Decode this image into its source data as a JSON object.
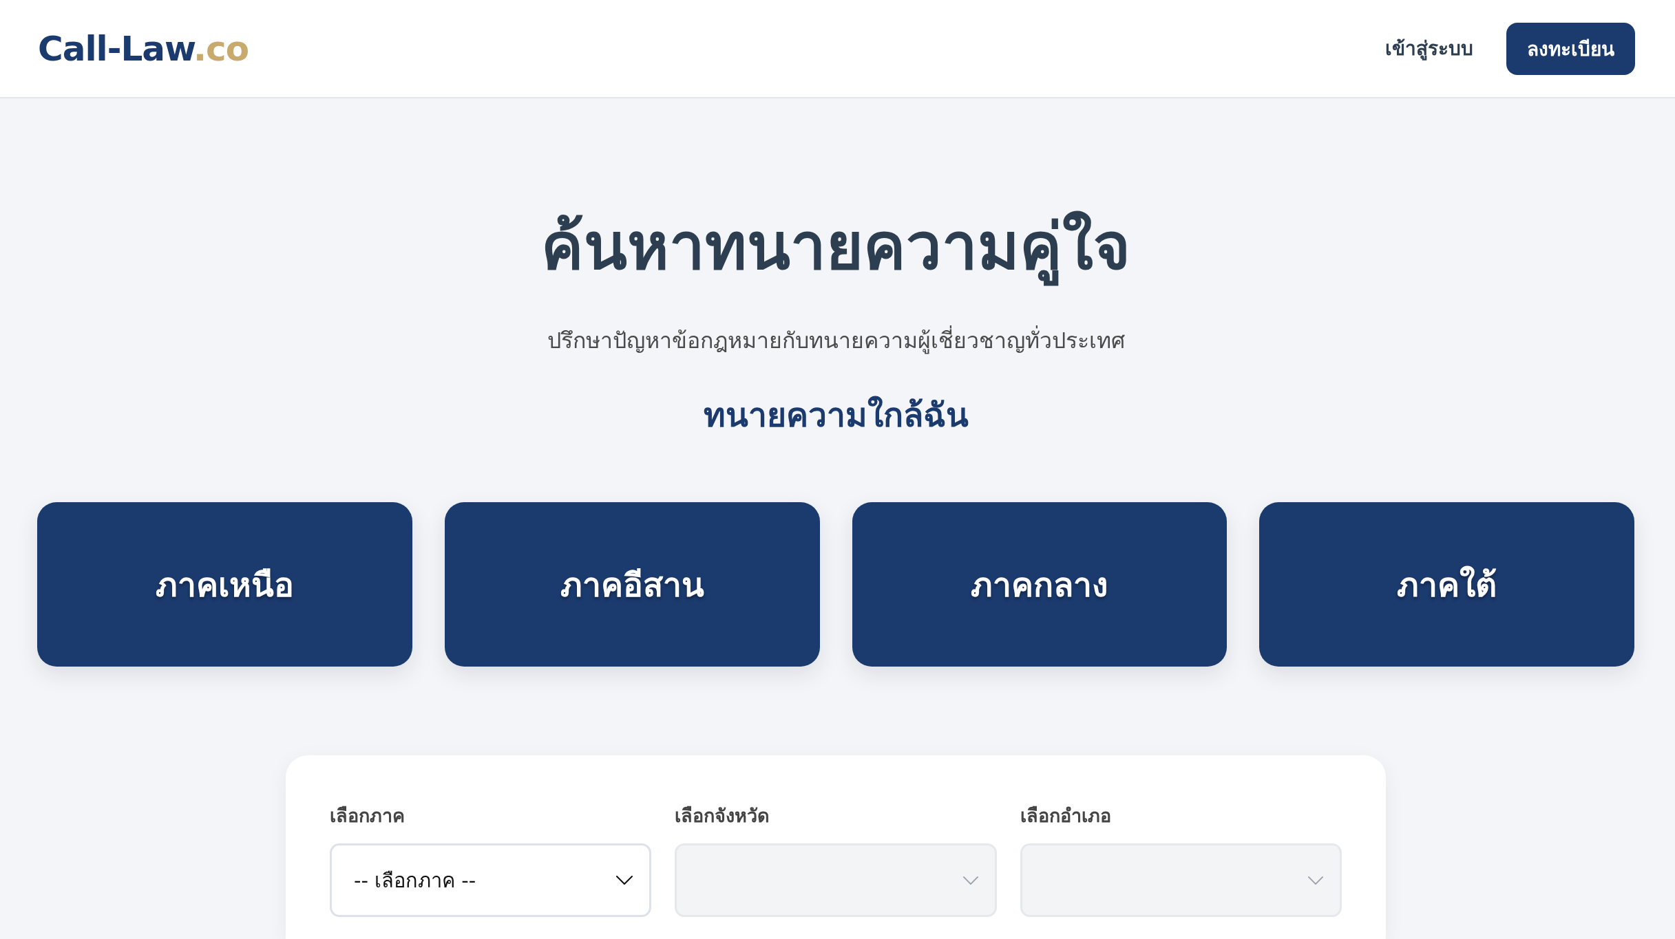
{
  "header": {
    "logo": {
      "main": "Call-Law",
      "suffix": ".co"
    },
    "nav": [
      {
        "label": "เข้าสู่ระบบ",
        "kind": "link"
      },
      {
        "label": "ลงทะเบียน",
        "kind": "button"
      }
    ]
  },
  "hero": {
    "title": "ค้นหาทนายความคู่ใจ",
    "subtitle": "ปรึกษาปัญหาข้อกฎหมายกับทนายความผู้เชี่ยวชาญทั่วประเทศ",
    "section_title": "ทนายความใกล้ฉัน"
  },
  "regions": [
    {
      "label": "ภาคเหนือ"
    },
    {
      "label": "ภาคอีสาน"
    },
    {
      "label": "ภาคกลาง"
    },
    {
      "label": "ภาคใต้"
    }
  ],
  "search_form": {
    "fields": [
      {
        "label": "เลือกภาค",
        "value": "-- เลือกภาค --",
        "disabled": false
      },
      {
        "label": "เลือกจังหวัด",
        "disabled": true
      },
      {
        "label": "เลือกอำเภอ",
        "disabled": true
      }
    ]
  }
}
